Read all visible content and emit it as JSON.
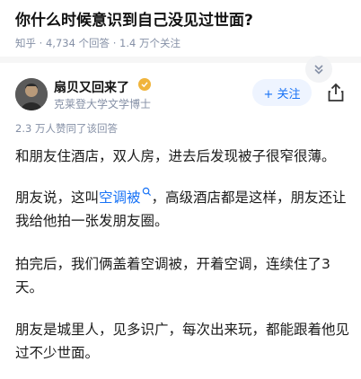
{
  "question": {
    "title": "你什么时候意识到自己没见过世面?",
    "source": "知乎",
    "answers": "4,734 个回答",
    "followers": "1.4 万个关注"
  },
  "answer": {
    "author": {
      "name": "扇贝又回来了",
      "bio": "克莱登大学文学博士"
    },
    "follow_label": "+ 关注",
    "upvote_meta": "2.3 万人赞同了该回答",
    "paragraphs": {
      "p1": "和朋友住酒店，双人房，进去后发现被子很窄很薄。",
      "p2_before": "朋友说，这叫",
      "p2_link": "空调被",
      "p2_after": "，高级酒店都是这样，朋友还让我给他拍一张发朋友圈。",
      "p3": "拍完后，我们俩盖着空调被，开着空调，连续住了3天。",
      "p4": "朋友是城里人，见多识广，每次出来玩，都能跟着他见过不少世面。"
    }
  },
  "colors": {
    "accent": "#1772f6",
    "meta": "#8590a6",
    "badge": "#f0b43c"
  },
  "icons": [
    "chevron-double-down-icon",
    "share-icon",
    "search-icon",
    "badge-icon"
  ]
}
